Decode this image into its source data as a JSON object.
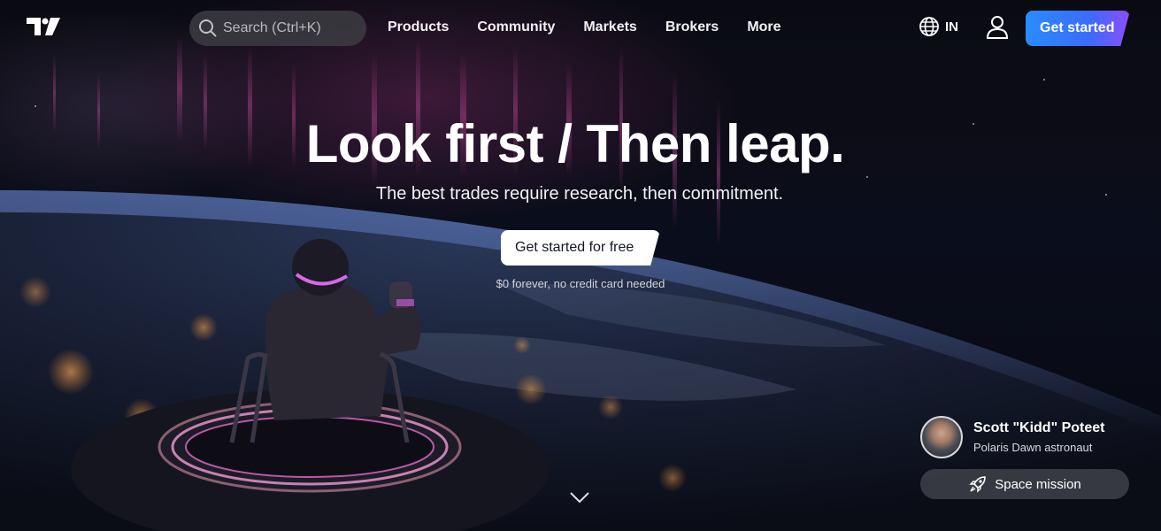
{
  "nav": {
    "logo": "TradingView logo",
    "search_placeholder": "Search (Ctrl+K)",
    "links": [
      "Products",
      "Community",
      "Markets",
      "Brokers",
      "More"
    ],
    "lang": "IN",
    "cta": "Get started"
  },
  "hero": {
    "headline": "Look first / Then leap.",
    "subhead": "The best trades require research, then commitment.",
    "cta": "Get started for free",
    "note": "$0 forever, no credit card needed"
  },
  "spotlight": {
    "name": "Scott \"Kidd\" Poteet",
    "role": "Polaris Dawn astronaut",
    "button": "Space mission"
  },
  "colors": {
    "accent_start": "#2a8cff",
    "accent_end": "#8b4dff",
    "background": "#050609"
  },
  "icons": [
    "search-icon",
    "globe-icon",
    "user-icon",
    "rocket-icon",
    "chevron-down-icon"
  ]
}
